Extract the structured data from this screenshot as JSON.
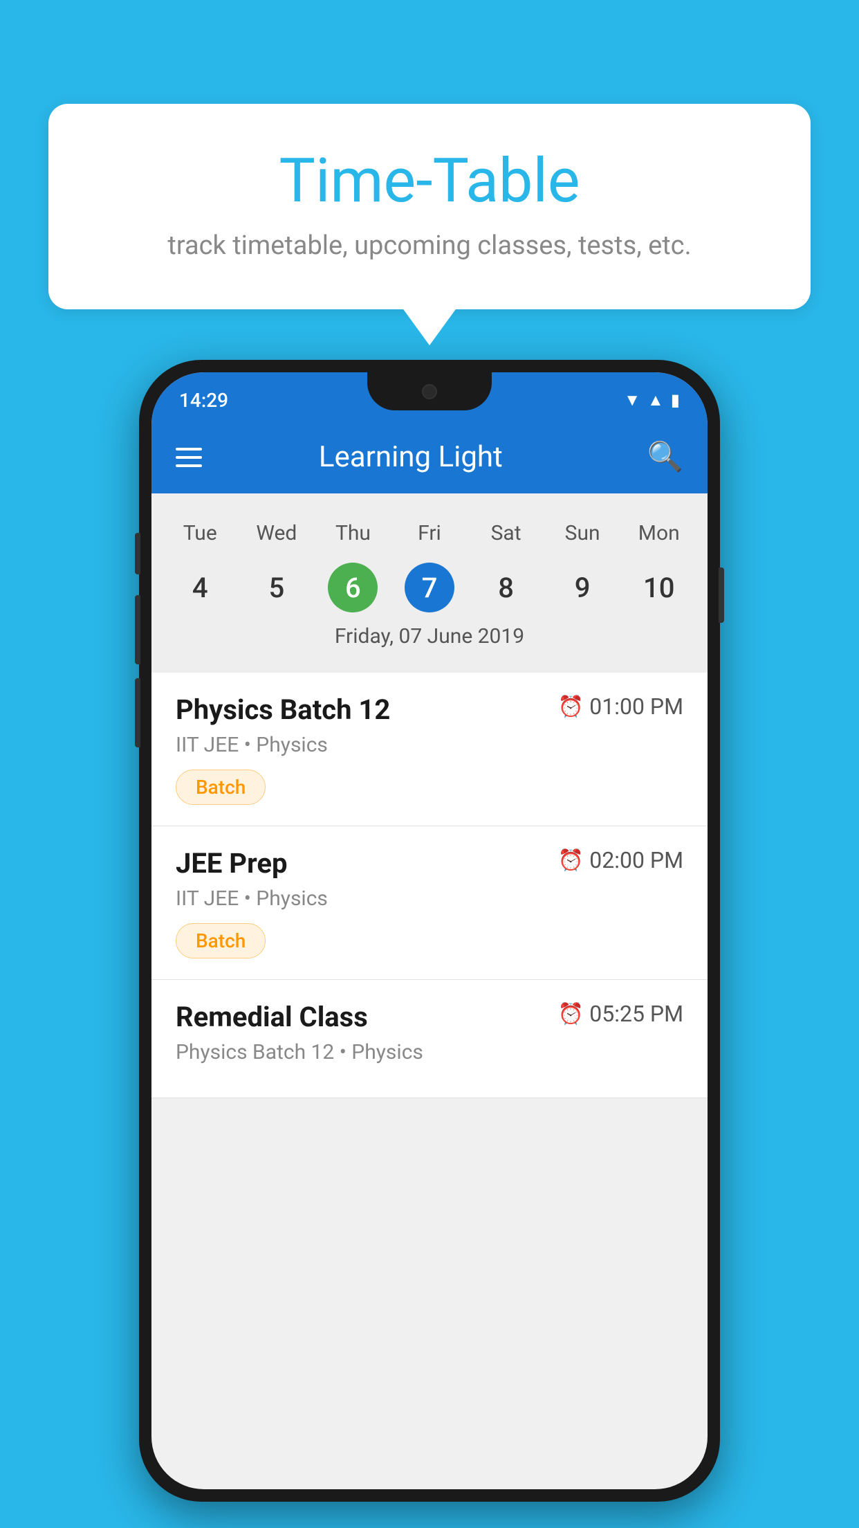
{
  "background_color": "#29b6e8",
  "speech_bubble": {
    "title": "Time-Table",
    "subtitle": "track timetable, upcoming classes, tests, etc."
  },
  "phone": {
    "status_bar": {
      "time": "14:29"
    },
    "app_bar": {
      "title": "Learning Light"
    },
    "calendar": {
      "days": [
        "Tue",
        "Wed",
        "Thu",
        "Fri",
        "Sat",
        "Sun",
        "Mon"
      ],
      "dates": [
        "4",
        "5",
        "6",
        "7",
        "8",
        "9",
        "10"
      ],
      "today_index": 2,
      "selected_index": 3,
      "selected_date_label": "Friday, 07 June 2019"
    },
    "schedule": [
      {
        "title": "Physics Batch 12",
        "time": "01:00 PM",
        "subtitle": "IIT JEE • Physics",
        "badge": "Batch"
      },
      {
        "title": "JEE Prep",
        "time": "02:00 PM",
        "subtitle": "IIT JEE • Physics",
        "badge": "Batch"
      },
      {
        "title": "Remedial Class",
        "time": "05:25 PM",
        "subtitle": "Physics Batch 12 • Physics",
        "badge": null
      }
    ]
  }
}
